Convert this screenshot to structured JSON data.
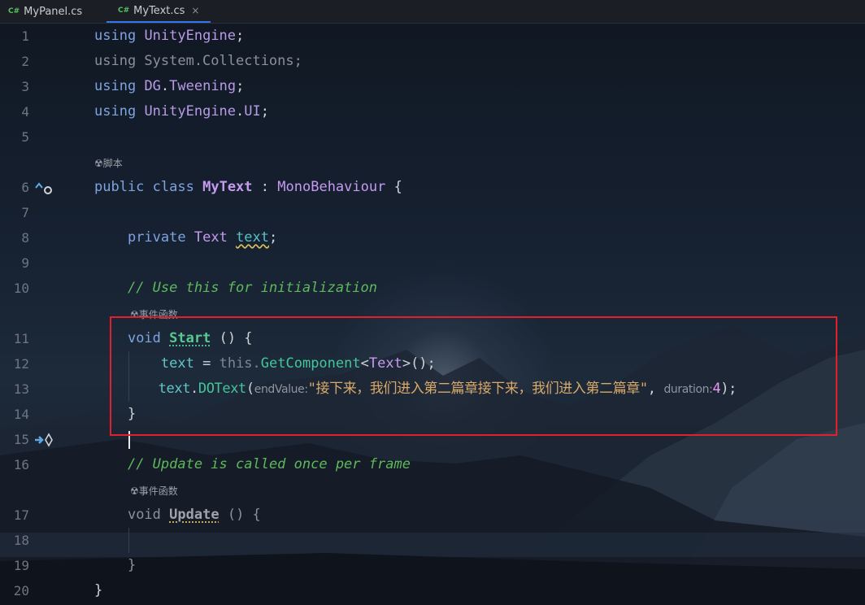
{
  "tabs": [
    {
      "lang": "C#",
      "label": "MyPanel.cs",
      "active": false
    },
    {
      "lang": "C#",
      "label": "MyText.cs",
      "active": true,
      "close": "×"
    }
  ],
  "line_numbers": [
    "1",
    "2",
    "3",
    "4",
    "5",
    "6",
    "7",
    "8",
    "9",
    "10",
    "11",
    "12",
    "13",
    "14",
    "15",
    "16",
    "17",
    "18",
    "19",
    "20"
  ],
  "hints": {
    "script": "脚本",
    "event_fn_1": "事件函数",
    "event_fn_2": "事件函数"
  },
  "code": {
    "l1": {
      "kw": "using",
      "ns": "UnityEngine",
      "end": ";"
    },
    "l2": {
      "text": "using System.Collections;"
    },
    "l3": {
      "kw": "using",
      "ns1": "DG",
      "dot": ".",
      "ns2": "Tweening",
      "end": ";"
    },
    "l4": {
      "kw": "using",
      "ns1": "UnityEngine",
      "dot": ".",
      "ns2": "UI",
      "end": ";"
    },
    "l6": {
      "kw1": "public",
      "kw2": "class",
      "name": "MyText",
      "colon": ":",
      "base": "MonoBehaviour",
      "brace": "{"
    },
    "l8": {
      "kw": "private",
      "type": "Text",
      "field": "text",
      "end": ";"
    },
    "l10": {
      "comment": "// Use this for initialization"
    },
    "l11": {
      "kw": "void",
      "method": "Start",
      "rest": "() {"
    },
    "l12": {
      "var": "text",
      "eq": "=",
      "this": "this.",
      "call": "GetComponent",
      "lt": "<",
      "type": "Text",
      "gt": ">",
      "end": "();"
    },
    "l13": {
      "var": "text",
      "dot": ".",
      "call": "DOText",
      "open": "(",
      "p1": "endValue:",
      "str": "\"接下来，我们进入第二篇章接下来，我们进入第二篇章\"",
      "comma": ",",
      "p2": "duration:",
      "num": "4",
      "end": ");"
    },
    "l14": {
      "brace": "}"
    },
    "l16": {
      "comment": "// Update is called once per frame"
    },
    "l17": {
      "kw": "void",
      "method": "Update",
      "rest": "() {"
    },
    "l19": {
      "brace": "}"
    },
    "l20": {
      "brace": "}"
    }
  },
  "colors": {
    "highlight_box": "#e0212c",
    "tab_accent": "#3574f0"
  }
}
